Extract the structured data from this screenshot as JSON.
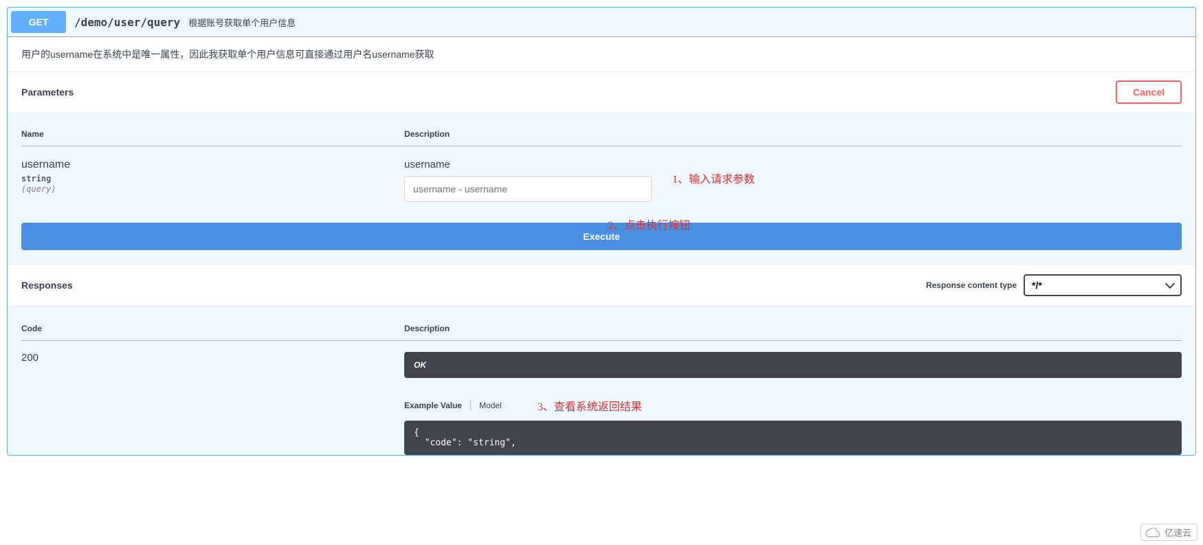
{
  "op": {
    "method": "GET",
    "path": "/demo/user/query",
    "summary": "根据账号获取单个用户信息",
    "description": "用户的username在系统中是唯一属性，因此我获取单个用户信息可直接通过用户名username获取"
  },
  "labels": {
    "parameters": "Parameters",
    "cancel": "Cancel",
    "name_col": "Name",
    "desc_col": "Description",
    "execute": "Execute",
    "responses": "Responses",
    "content_type": "Response content type",
    "code_col": "Code",
    "desc_col2": "Description",
    "example_value": "Example Value",
    "model": "Model"
  },
  "parameters": [
    {
      "name": "username",
      "type": "string",
      "in": "(query)",
      "desc_label": "username",
      "placeholder": "username - username"
    }
  ],
  "annotations": {
    "a1": "1、输入请求参数",
    "a2": "2、点击执行按钮",
    "a3": "3、查看系统返回结果"
  },
  "responses": {
    "content_type_value": "*/*",
    "rows": [
      {
        "code": "200",
        "message": "OK",
        "example_json": "{\n  \"code\": \"string\","
      }
    ]
  },
  "watermark": "亿速云"
}
